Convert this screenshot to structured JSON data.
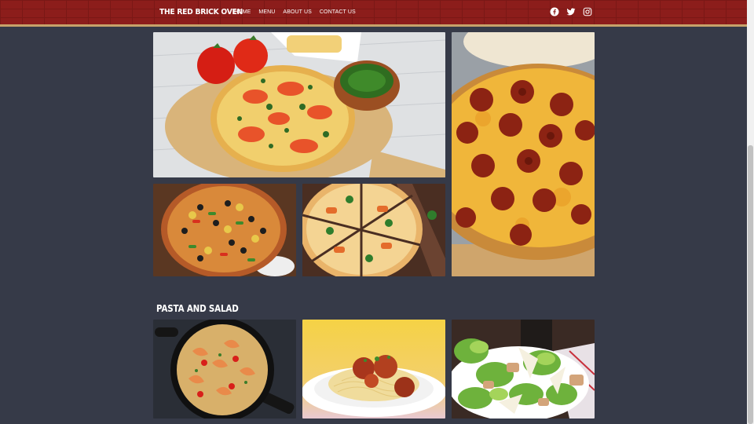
{
  "header": {
    "brand": "THE RED BRICK OVEN",
    "nav": [
      {
        "label": "HOME"
      },
      {
        "label": "MENU"
      },
      {
        "label": "ABOUT US"
      },
      {
        "label": "CONTACT US"
      }
    ],
    "social_icons": [
      "facebook-icon",
      "twitter-icon",
      "instagram-icon"
    ]
  },
  "sections": {
    "pasta_title": "PASTA AND SALAD"
  },
  "gallery": {
    "pizza_photos": [
      "margherita-pizza-photo",
      "pepperoni-pizza-photo",
      "veggie-pizza-photo",
      "chicken-pizza-photo"
    ],
    "pasta_salad_photos": [
      "shrimp-pasta-photo",
      "spaghetti-meatballs-photo",
      "caesar-salad-photo"
    ]
  },
  "colors": {
    "background": "#363a48",
    "header_brick": "#8c1d1b",
    "header_border": "#c7a26a"
  }
}
